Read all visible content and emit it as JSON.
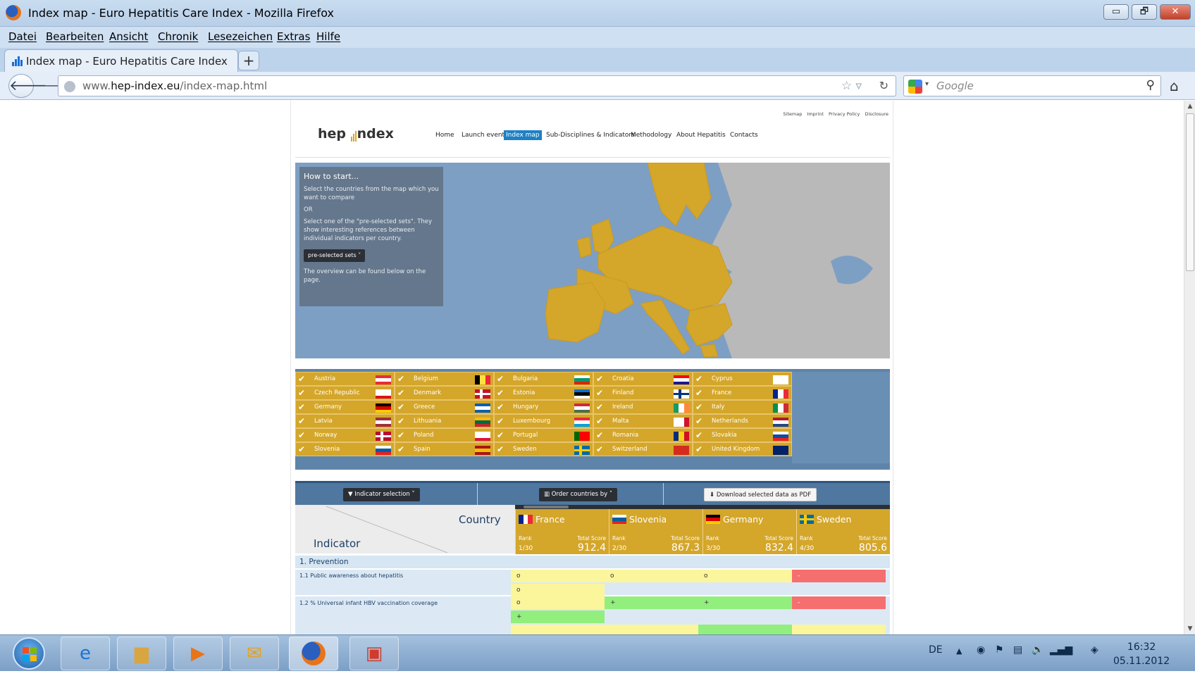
{
  "window": {
    "title": "Index map - Euro Hepatitis Care Index",
    "min": "▭",
    "max": "🗗",
    "close": "✕"
  },
  "menu": [
    "Datei",
    "Bearbeiten",
    "Ansicht",
    "Chronik",
    "Lesezeichen",
    "Extras",
    "Hilfe"
  ],
  "tab": {
    "label": "Index map - Euro Hepatitis Care Index",
    "new_tab": "+"
  },
  "nav": {
    "url_domain_prefix": "www.",
    "url_domain": "hep-index.eu",
    "url_path": "/index-map.html",
    "search_placeholder": "Google"
  },
  "site": {
    "toplinks": [
      "Sitemap",
      "Imprint",
      "Privacy Policy",
      "Disclosure"
    ],
    "logo_left": "hep",
    "logo_right": "ndex",
    "nav": [
      "Home",
      "Launch event",
      "Index map",
      "Sub-Disciplines & Indicators",
      "Methodology",
      "About Hepatitis",
      "Contacts"
    ],
    "nav_active": "Index map"
  },
  "howto": {
    "heading": "How to start...",
    "p1": "Select the countries from the map which you want to compare",
    "or": "OR",
    "p2": "Select one of the \"pre-selected sets\". They show interesting references between individual indicators per country.",
    "button": "pre-selected sets ˅",
    "p3": "The overview can be found below on the page."
  },
  "countries": [
    [
      "Austria",
      "Belgium",
      "Bulgaria",
      "Croatia",
      "Cyprus"
    ],
    [
      "Czech Republic",
      "Denmark",
      "Estonia",
      "Finland",
      "France"
    ],
    [
      "Germany",
      "Greece",
      "Hungary",
      "Ireland",
      "Italy"
    ],
    [
      "Latvia",
      "Lithuania",
      "Luxembourg",
      "Malta",
      "Netherlands"
    ],
    [
      "Norway",
      "Poland",
      "Portugal",
      "Romania",
      "Slovakia"
    ],
    [
      "Slovenia",
      "Spain",
      "Sweden",
      "Switzerland",
      "United Kingdom"
    ]
  ],
  "toolbar": {
    "indicator_selection": "▼ Indicator selection ˅",
    "order_countries": "▥ Order countries by ˅",
    "download_pdf": "⬇ Download selected data as PDF"
  },
  "ranking": {
    "country_label": "Country",
    "indicator_label": "Indicator",
    "rank_label": "Rank",
    "score_label": "Total Score",
    "columns": [
      {
        "name": "France",
        "rank": "1/30",
        "score": "912.4"
      },
      {
        "name": "Slovenia",
        "rank": "2/30",
        "score": "867.3"
      },
      {
        "name": "Germany",
        "rank": "3/30",
        "score": "832.4"
      },
      {
        "name": "Sweden",
        "rank": "4/30",
        "score": "805.6"
      }
    ],
    "section": "1. Prevention",
    "rows": [
      {
        "label": "1.1 Public awareness about hepatitis",
        "marks": [
          "o",
          "o",
          "o",
          "-"
        ]
      },
      {
        "label": "1.2 % Universal infant HBV vaccination coverage",
        "marks": [
          "o",
          "+",
          "+",
          "-"
        ]
      }
    ],
    "extra_marks": [
      "o",
      "+"
    ]
  },
  "taskbar": {
    "lang": "DE",
    "time": "16:32",
    "date": "05.11.2012"
  }
}
